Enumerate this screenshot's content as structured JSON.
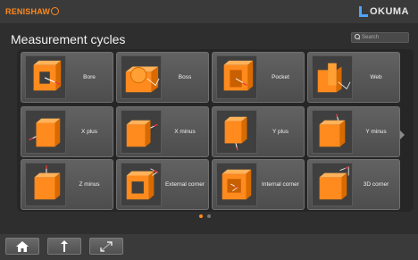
{
  "brands": {
    "left": "RENISHAW",
    "right": "OKUMA"
  },
  "page_title": "Measurement cycles",
  "search": {
    "placeholder": "Search"
  },
  "tiles": [
    {
      "label": "Bore",
      "icon": "bore-icon"
    },
    {
      "label": "Boss",
      "icon": "boss-icon"
    },
    {
      "label": "Pocket",
      "icon": "pocket-icon"
    },
    {
      "label": "Web",
      "icon": "web-icon"
    },
    {
      "label": "X plus",
      "icon": "x-plus-icon"
    },
    {
      "label": "X minus",
      "icon": "x-minus-icon"
    },
    {
      "label": "Y plus",
      "icon": "y-plus-icon"
    },
    {
      "label": "Y minus",
      "icon": "y-minus-icon"
    },
    {
      "label": "Z minus",
      "icon": "z-minus-icon"
    },
    {
      "label": "External corner",
      "icon": "external-corner-icon"
    },
    {
      "label": "Internal corner",
      "icon": "internal-corner-icon"
    },
    {
      "label": "3D corner",
      "icon": "3d-corner-icon"
    }
  ],
  "pagination": {
    "current_page": 1,
    "total_pages": 2
  },
  "colors": {
    "accent": "#ff8a1e",
    "brand_blue": "#4ea3ff"
  },
  "bottom_buttons": [
    {
      "icon": "home-icon"
    },
    {
      "icon": "up-arrow-icon"
    },
    {
      "icon": "fullscreen-toggle-icon"
    }
  ]
}
